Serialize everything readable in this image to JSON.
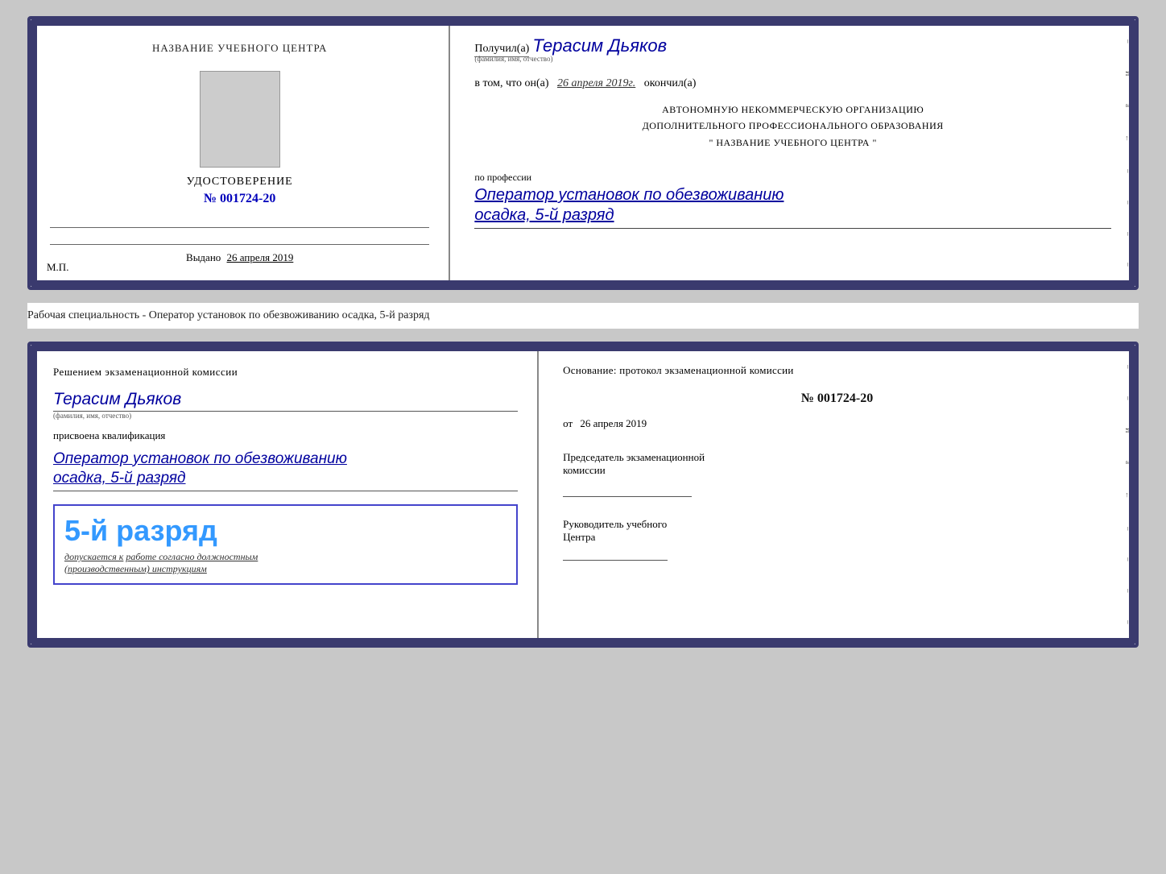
{
  "top_card": {
    "left": {
      "center_name": "НАЗВАНИЕ УЧЕБНОГО ЦЕНТРА",
      "cert_title": "УДОСТОВЕРЕНИЕ",
      "cert_number_label": "№",
      "cert_number": "001724-20",
      "issued_label": "Выдано",
      "issued_date": "26 апреля 2019",
      "mp_label": "М.П."
    },
    "right": {
      "recipient_prefix": "Получил(а)",
      "recipient_name": "Терасим Дьяков",
      "recipient_name_sublabel": "(фамилия, имя, отчество)",
      "date_prefix": "в том, что он(а)",
      "date_value": "26 апреля 2019г.",
      "date_suffix": "окончил(а)",
      "org_line1": "АВТОНОМНУЮ НЕКОММЕРЧЕСКУЮ ОРГАНИЗАЦИЮ",
      "org_line2": "ДОПОЛНИТЕЛЬНОГО ПРОФЕССИОНАЛЬНОГО ОБРАЗОВАНИЯ",
      "org_line3": "\" НАЗВАНИЕ УЧЕБНОГО ЦЕНТРА \"",
      "profession_label": "по профессии",
      "profession_value": "Оператор установок по обезвоживанию",
      "rank_value": "осадка, 5-й разряд"
    }
  },
  "specialty_desc": "Рабочая специальность - Оператор установок по обезвоживанию осадка, 5-й разряд",
  "bottom_card": {
    "left": {
      "decision_text": "Решением экзаменационной комиссии",
      "name": "Терасим Дьяков",
      "name_sublabel": "(фамилия, имя, отчество)",
      "assigned_text": "присвоена квалификация",
      "qualification_value": "Оператор установок по обезвоживанию",
      "rank_value": "осадка, 5-й разряд",
      "badge_rank": "5-й разряд",
      "allowed_prefix": "допускается к",
      "allowed_italic": "работе согласно должностным",
      "allowed_italic2": "(производственным) инструкциям"
    },
    "right": {
      "basis_text": "Основание: протокол экзаменационной комиссии",
      "protocol_number": "№ 001724-20",
      "date_prefix": "от",
      "date_value": "26 апреля 2019",
      "chairman_label": "Председатель экзаменационной",
      "chairman_label2": "комиссии",
      "head_label1": "Руководитель учебного",
      "head_label2": "Центра"
    }
  },
  "side_items": [
    "И",
    "а",
    "←",
    "–",
    "–",
    "–",
    "–"
  ],
  "side_items2": [
    "И",
    "а",
    "←",
    "–",
    "–",
    "–",
    "–"
  ]
}
